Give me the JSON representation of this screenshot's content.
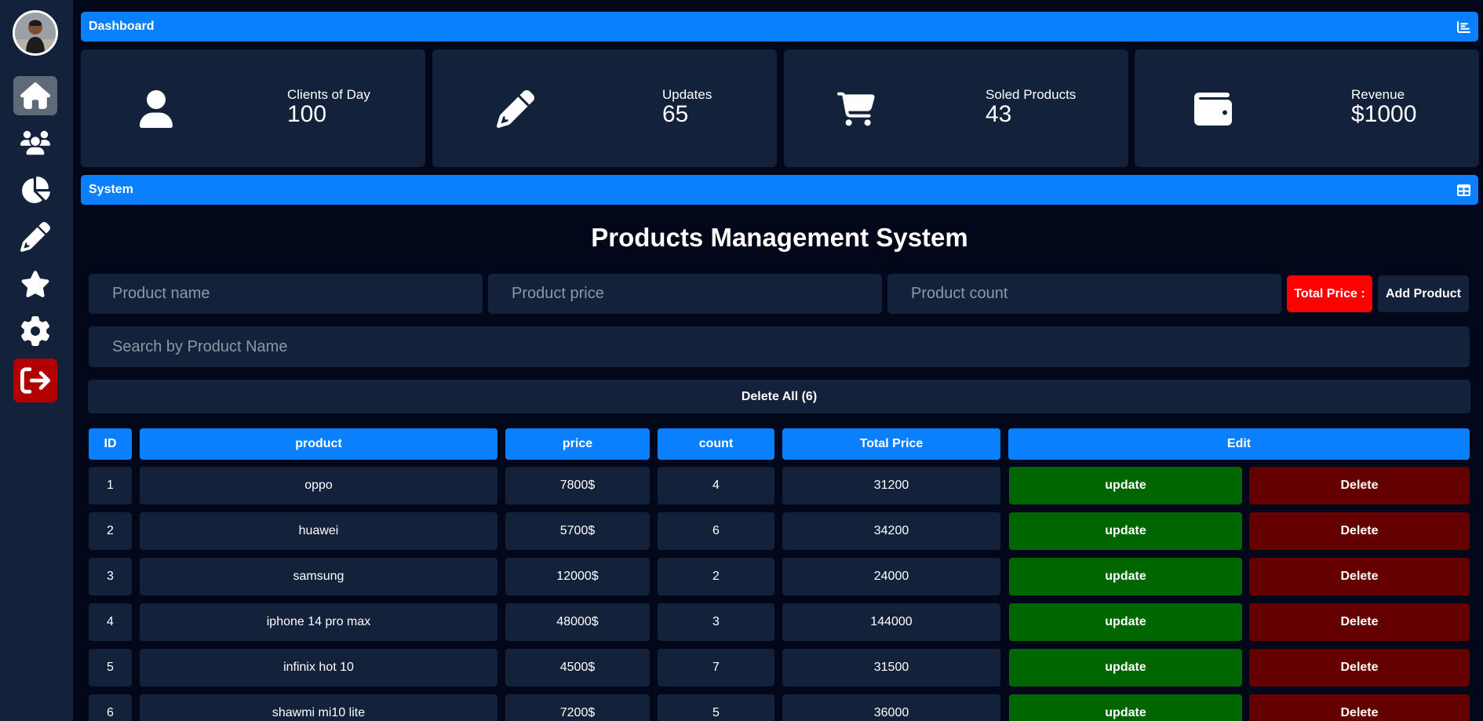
{
  "sidebar": {
    "items": [
      {
        "icon": "home-icon",
        "active": true
      },
      {
        "icon": "users-icon",
        "active": false
      },
      {
        "icon": "chart-pie-icon",
        "active": false
      },
      {
        "icon": "pencil-icon",
        "active": false
      },
      {
        "icon": "star-icon",
        "active": false
      },
      {
        "icon": "gear-icon",
        "active": false
      },
      {
        "icon": "sign-out-icon",
        "active": false
      }
    ]
  },
  "dashboard": {
    "title": "Dashboard",
    "cards": [
      {
        "label": "Clients of Day",
        "value": "100",
        "icon": "user-icon"
      },
      {
        "label": "Updates",
        "value": "65",
        "icon": "pencil-icon"
      },
      {
        "label": "Soled Products",
        "value": "43",
        "icon": "cart-icon"
      },
      {
        "label": "Revenue",
        "value": "$1000",
        "icon": "wallet-icon"
      }
    ]
  },
  "system": {
    "title": "System",
    "heading": "Products Management System",
    "name_placeholder": "Product name",
    "price_placeholder": "Product price",
    "count_placeholder": "Product count",
    "total_label": "Total Price :",
    "add_label": "Add Product",
    "search_placeholder": "Search by Product Name",
    "delete_all_label": "Delete All (6)"
  },
  "table": {
    "headers": [
      "ID",
      "product",
      "price",
      "count",
      "Total Price",
      "Edit"
    ],
    "rows": [
      {
        "id": "1",
        "product": "oppo",
        "price": "7800$",
        "count": "4",
        "total": "31200",
        "update": "update",
        "delete": "Delete"
      },
      {
        "id": "2",
        "product": "huawei",
        "price": "5700$",
        "count": "6",
        "total": "34200",
        "update": "update",
        "delete": "Delete"
      },
      {
        "id": "3",
        "product": "samsung",
        "price": "12000$",
        "count": "2",
        "total": "24000",
        "update": "update",
        "delete": "Delete"
      },
      {
        "id": "4",
        "product": "iphone 14 pro max",
        "price": "48000$",
        "count": "3",
        "total": "144000",
        "update": "update",
        "delete": "Delete"
      },
      {
        "id": "5",
        "product": "infinix hot 10",
        "price": "4500$",
        "count": "7",
        "total": "31500",
        "update": "update",
        "delete": "Delete"
      },
      {
        "id": "6",
        "product": "shawmi mi10 lite",
        "price": "7200$",
        "count": "5",
        "total": "36000",
        "update": "update",
        "delete": "Delete"
      }
    ]
  },
  "colors": {
    "accent": "#0b80ff",
    "panel": "#13213a",
    "background": "#03071a",
    "danger": "#ff0000",
    "update": "#006600",
    "delete": "#650000",
    "logout": "#b20000"
  }
}
